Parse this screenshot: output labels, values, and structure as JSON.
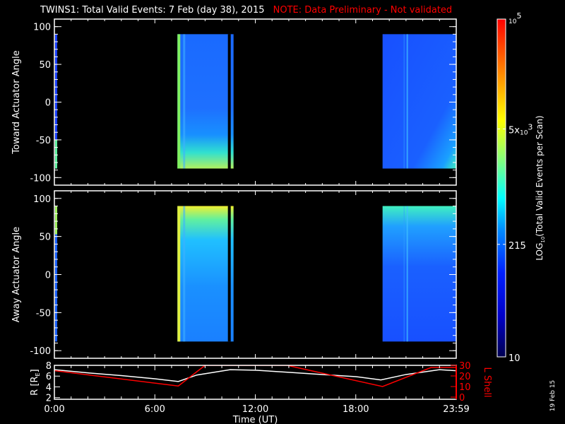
{
  "title": {
    "main": "TWINS1: Total Valid Events:  7 Feb (day  38), 2015",
    "note": "NOTE: Data Preliminary - Not validated"
  },
  "colors": {
    "note": "#ff0000",
    "axes": "#ffffff",
    "lshell": "#ff0000",
    "r_line": "#ffffff"
  },
  "chart_data": [
    {
      "type": "heatmap",
      "name": "toward",
      "ylabel": "Toward Actuator Angle",
      "ylim": [
        -110,
        110
      ],
      "yticks": [
        "100",
        "50",
        "0",
        "-50",
        "-100"
      ],
      "ytick_values": [
        100,
        50,
        0,
        -50,
        -100
      ],
      "data_blocks_hours": [
        [
          7.35,
          10.7
        ],
        [
          19.6,
          24.0
        ]
      ],
      "angle_range": [
        -88,
        90
      ]
    },
    {
      "type": "heatmap",
      "name": "away",
      "ylabel": "Away Actuator Angle",
      "ylim": [
        -110,
        110
      ],
      "yticks": [
        "100",
        "50",
        "0",
        "-50",
        "-100"
      ],
      "ytick_values": [
        100,
        50,
        0,
        -50,
        -100
      ],
      "data_blocks_hours": [
        [
          7.35,
          10.7
        ],
        [
          19.6,
          24.0
        ]
      ],
      "angle_range": [
        -88,
        90
      ]
    },
    {
      "type": "line",
      "name": "orbit",
      "xlabel": "Time (UT)",
      "xticks": [
        "0:00",
        "6:00",
        "12:00",
        "18:00",
        "23:59"
      ],
      "xtick_values": [
        0,
        6,
        12,
        18,
        24
      ],
      "ylabel_left": "R [R",
      "ylabel_left_sub": "E",
      "ylabel_left_end": "]",
      "ylabel_right": "L Shell",
      "yticks_left": [
        "8",
        "6",
        "4",
        "2"
      ],
      "ytick_values_left": [
        8,
        6,
        4,
        2
      ],
      "yticks_right": [
        "30",
        "20",
        "10",
        "0"
      ],
      "ytick_values_right": [
        30,
        20,
        10,
        0
      ],
      "ylim_left": [
        1.7,
        8
      ],
      "ylim_right": [
        -2,
        30
      ],
      "series": [
        {
          "name": "R",
          "x": [
            0,
            2,
            4,
            6,
            7.4,
            8.5,
            10.5,
            12,
            14,
            16,
            18,
            19.5,
            21,
            23,
            24
          ],
          "values": [
            7.2,
            6.6,
            6.1,
            5.5,
            5.0,
            6.2,
            7.2,
            7.1,
            6.7,
            6.3,
            5.9,
            5.3,
            6.3,
            7.2,
            7.0
          ]
        },
        {
          "name": "L Shell",
          "x": [
            0,
            7.4,
            9.0,
            13.9,
            19.6,
            22.5,
            24
          ],
          "values": [
            25,
            10.5,
            30,
            30,
            10,
            28,
            28
          ]
        }
      ]
    }
  ],
  "colorbar": {
    "label_prefix": "LOG",
    "label_sub": "10",
    "label_rest": "(Total Valid Events per Scan)",
    "ticks": [
      {
        "base": "10",
        "exp": "5",
        "pre": "",
        "value": 100000
      },
      {
        "base": "10",
        "exp": "3",
        "pre": "5x",
        "value": 5000
      },
      {
        "base": "",
        "exp": "",
        "pre": "215",
        "value": 215
      },
      {
        "base": "",
        "exp": "",
        "pre": "10",
        "value": 10
      }
    ],
    "range": [
      10,
      100000
    ]
  },
  "date_stamp": "19 Feb 15"
}
